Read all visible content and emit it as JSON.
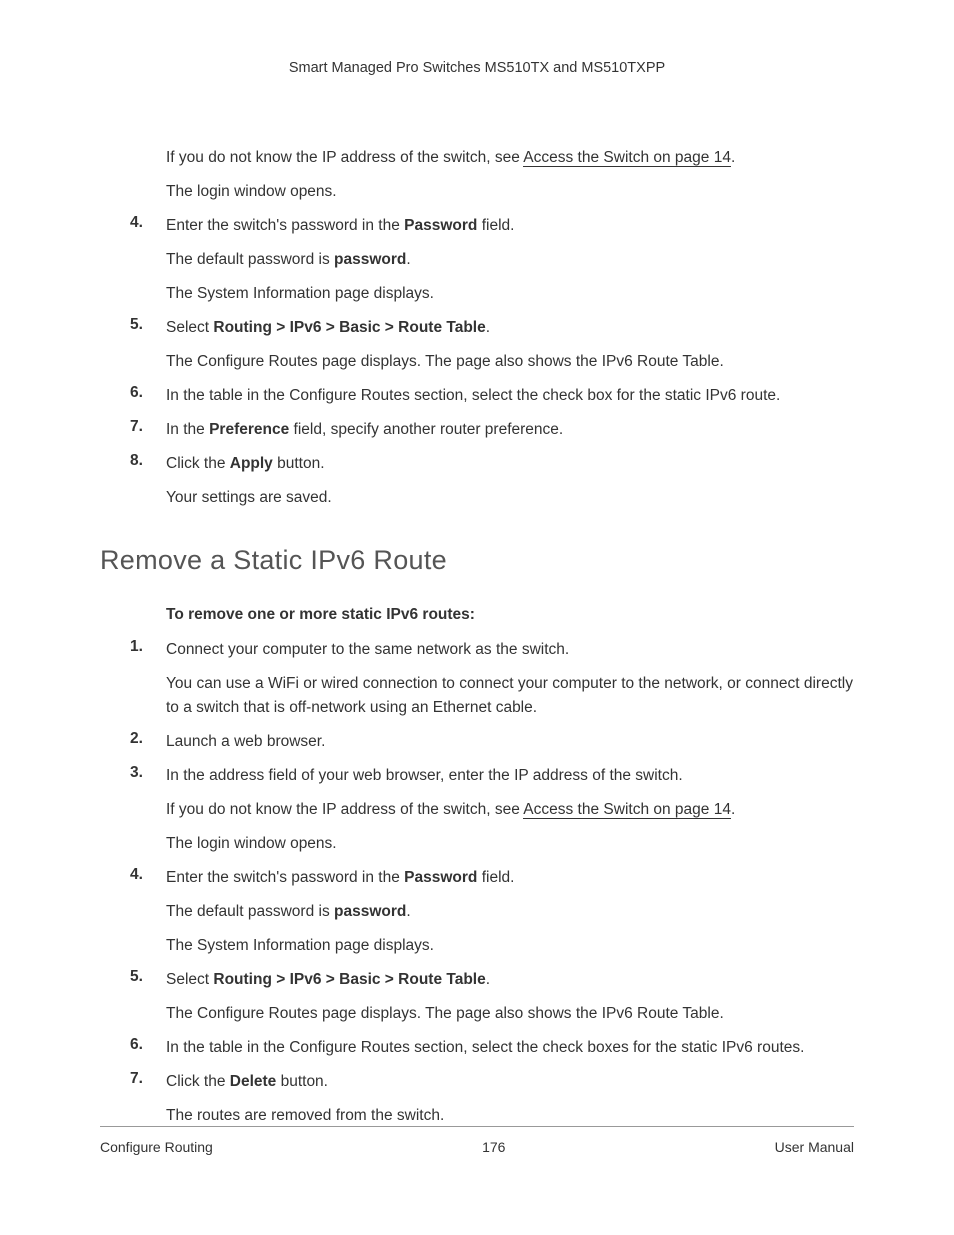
{
  "header": {
    "title": "Smart Managed Pro Switches MS510TX and MS510TXPP"
  },
  "section1": {
    "preText1a": "If you do not know the IP address of the switch, see ",
    "preLink": "Access the Switch on page 14",
    "preText1b": ".",
    "preText2": "The login window opens.",
    "step4a": "Enter the switch's password in the ",
    "step4b": "Password",
    "step4c": " field.",
    "step4sub1a": "The default password is ",
    "step4sub1b": "password",
    "step4sub1c": ".",
    "step4sub2": "The System Information page displays.",
    "step5a": "Select ",
    "step5b": "Routing > IPv6 > Basic > Route Table",
    "step5c": ".",
    "step5sub": "The Configure Routes page displays. The page also shows the IPv6 Route Table.",
    "step6": "In the table in the Configure Routes section, select the check box for the static IPv6 route.",
    "step7a": "In the ",
    "step7b": "Preference",
    "step7c": " field, specify another router preference.",
    "step8a": "Click the ",
    "step8b": "Apply",
    "step8c": " button.",
    "step8sub": "Your settings are saved.",
    "num4": "4.",
    "num5": "5.",
    "num6": "6.",
    "num7": "7.",
    "num8": "8."
  },
  "heading": "Remove a Static IPv6 Route",
  "section2": {
    "intro": "To remove one or more static IPv6 routes:",
    "num1": "1.",
    "num2": "2.",
    "num3": "3.",
    "num4": "4.",
    "num5": "5.",
    "num6": "6.",
    "num7": "7.",
    "step1": "Connect your computer to the same network as the switch.",
    "step1sub": "You can use a WiFi or wired connection to connect your computer to the network, or connect directly to a switch that is off-network using an Ethernet cable.",
    "step2": "Launch a web browser.",
    "step3": "In the address field of your web browser, enter the IP address of the switch.",
    "step3sub1a": "If you do not know the IP address of the switch, see ",
    "step3sub1link": "Access the Switch on page 14",
    "step3sub1b": ".",
    "step3sub2": "The login window opens.",
    "step4a": "Enter the switch's password in the ",
    "step4b": "Password",
    "step4c": " field.",
    "step4sub1a": "The default password is ",
    "step4sub1b": "password",
    "step4sub1c": ".",
    "step4sub2": "The System Information page displays.",
    "step5a": "Select ",
    "step5b": "Routing > IPv6 > Basic > Route Table",
    "step5c": ".",
    "step5sub": "The Configure Routes page displays. The page also shows the IPv6 Route Table.",
    "step6": "In the table in the Configure Routes section, select the check boxes for the static IPv6 routes.",
    "step7a": "Click the ",
    "step7b": "Delete",
    "step7c": " button.",
    "step7sub": "The routes are removed from the switch."
  },
  "footer": {
    "left": "Configure Routing",
    "center": "176",
    "right": "User Manual"
  }
}
